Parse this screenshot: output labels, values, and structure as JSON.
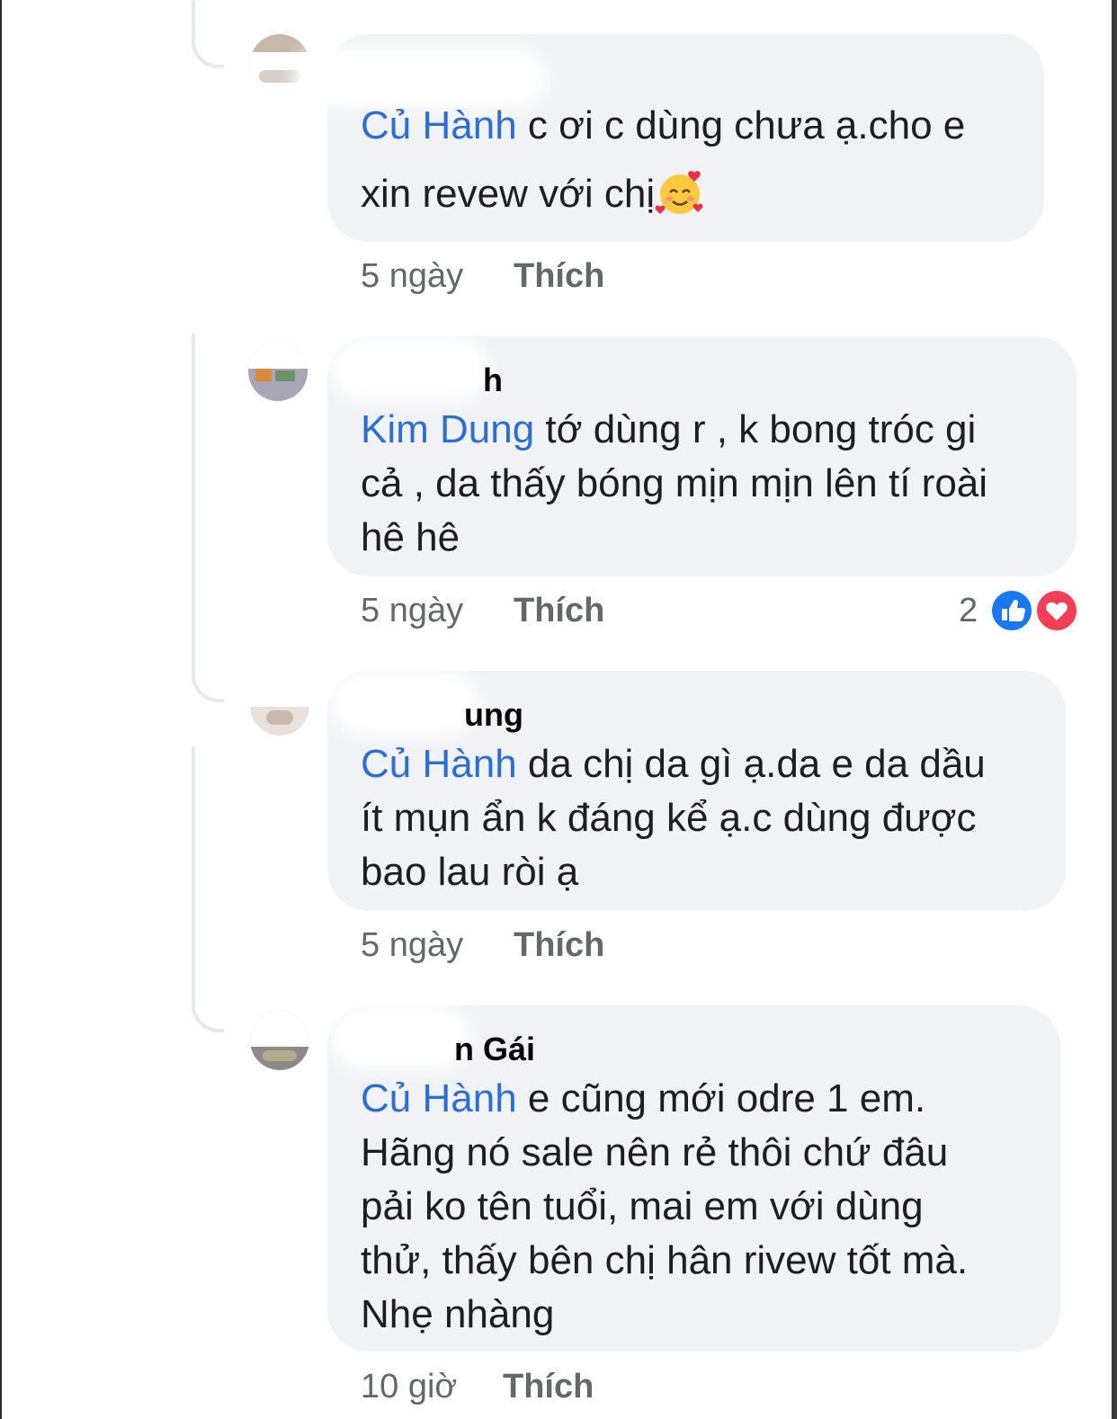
{
  "comments": [
    {
      "author": "",
      "mention": "Củ Hành",
      "text_line1": " c ơi c dùng chưa ạ.cho e",
      "text_line2": "xin revew với chị",
      "emoji": "smiling-face-with-hearts-icon",
      "time": "5 ngày",
      "like_label": "Thích"
    },
    {
      "author": "h",
      "mention": "Kim Dung",
      "text_line1": " tớ dùng r , k bong tróc gi",
      "text_line2": "cả , da thấy bóng mịn mịn lên tí roài",
      "text_line3": "hê hê",
      "time": "5 ngày",
      "like_label": "Thích",
      "reaction_count": "2",
      "reactions": [
        "like-icon",
        "love-icon"
      ]
    },
    {
      "author": "ung",
      "mention": "Củ Hành",
      "text_line1": " da chị da gì ạ.da e da dầu",
      "text_line2": "ít mụn ẩn k đáng kể ạ.c dùng được",
      "text_line3": "bao lau ròi ạ",
      "time": "5 ngày",
      "like_label": "Thích"
    },
    {
      "author": "n Gái",
      "mention": "Củ Hành",
      "text_line1": " e cũng mới odre 1 em.",
      "text_line2": "Hãng nó sale nên rẻ thôi chứ đâu",
      "text_line3": "pải ko tên tuổi, mai em với dùng",
      "text_line4": "thử, thấy bên chị hân rivew tốt mà.",
      "text_line5": "Nhẹ nhàng",
      "time": "10 giờ",
      "like_label": "Thích"
    }
  ],
  "colors": {
    "mention": "#2d6ed4",
    "bubble": "#f0f2f5",
    "meta": "#65676b",
    "like_blue": "#1877f2",
    "love_red": "#f33e58"
  }
}
